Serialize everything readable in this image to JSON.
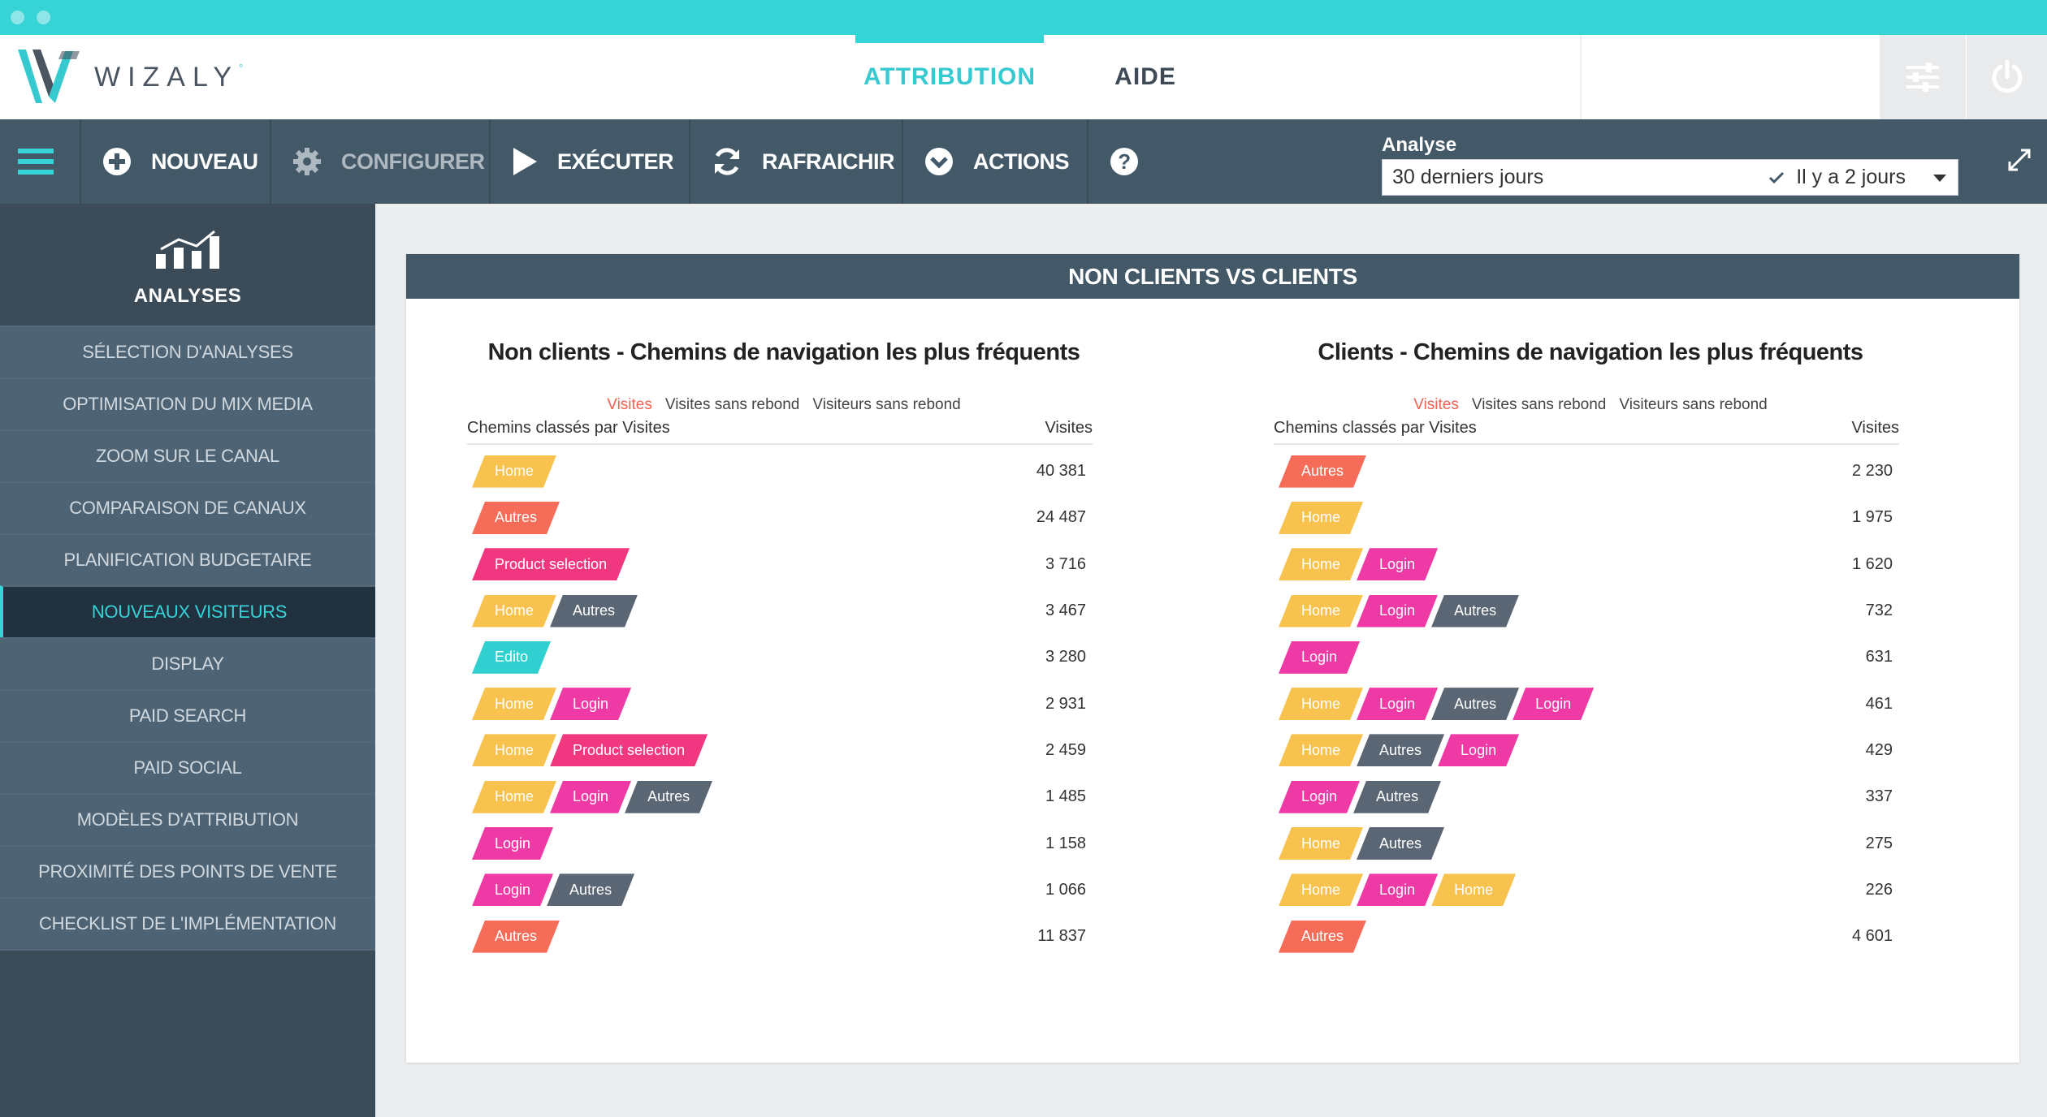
{
  "brand": {
    "name": "WIZALY",
    "mark": "°"
  },
  "top_nav": {
    "tabs": [
      "ATTRIBUTION",
      "AIDE"
    ],
    "active": 0
  },
  "toolbar": {
    "nouveau": "NOUVEAU",
    "configurer": "CONFIGURER",
    "executer": "EXÉCUTER",
    "rafraichir": "RAFRAICHIR",
    "actions": "ACTIONS"
  },
  "analyse": {
    "label": "Analyse",
    "value": "30 derniers jours",
    "selected": "Il y a 2 jours"
  },
  "sidebar": {
    "title": "ANALYSES",
    "items": [
      "SÉLECTION D'ANALYSES",
      "OPTIMISATION DU MIX MEDIA",
      "ZOOM SUR LE CANAL",
      "COMPARAISON DE CANAUX",
      "PLANIFICATION BUDGETAIRE",
      "NOUVEAUX VISITEURS",
      "DISPLAY",
      "PAID SEARCH",
      "PAID SOCIAL",
      "MODÈLES D'ATTRIBUTION",
      "PROXIMITÉ DES POINTS DE VENTE",
      "CHECKLIST DE L'IMPLÉMENTATION"
    ],
    "active": 5
  },
  "card": {
    "title": "NON CLIENTS VS CLIENTS"
  },
  "chip_colors": {
    "Home": "#f8c24e",
    "Autres": "#5a6673",
    "Product selection": "#f0377f",
    "Login": "#ef3aa6",
    "Edito": "#2fd0cf"
  },
  "chip_colors_override": {
    "first_autres": "#f56c58"
  },
  "panels": [
    {
      "title": "Non clients - Chemins de navigation les plus fréquents",
      "legend": [
        "Visites",
        "Visites sans rebond",
        "Visiteurs sans rebond"
      ],
      "col_left": "Chemins classés par Visites",
      "col_right": "Visites",
      "rows": [
        {
          "path": [
            "Home"
          ],
          "value": "40 381"
        },
        {
          "path": [
            "Autres"
          ],
          "value": "24 487"
        },
        {
          "path": [
            "Product selection"
          ],
          "value": "3 716"
        },
        {
          "path": [
            "Home",
            "Autres"
          ],
          "value": "3 467"
        },
        {
          "path": [
            "Edito"
          ],
          "value": "3 280"
        },
        {
          "path": [
            "Home",
            "Login"
          ],
          "value": "2 931"
        },
        {
          "path": [
            "Home",
            "Product selection"
          ],
          "value": "2 459"
        },
        {
          "path": [
            "Home",
            "Login",
            "Autres"
          ],
          "value": "1 485"
        },
        {
          "path": [
            "Login"
          ],
          "value": "1 158"
        },
        {
          "path": [
            "Login",
            "Autres"
          ],
          "value": "1 066"
        },
        {
          "path": [
            "Autres"
          ],
          "value": "11 837"
        }
      ]
    },
    {
      "title": "Clients - Chemins de navigation les plus fréquents",
      "legend": [
        "Visites",
        "Visites sans rebond",
        "Visiteurs sans rebond"
      ],
      "col_left": "Chemins classés par Visites",
      "col_right": "Visites",
      "rows": [
        {
          "path": [
            "Autres"
          ],
          "value": "2 230"
        },
        {
          "path": [
            "Home"
          ],
          "value": "1 975"
        },
        {
          "path": [
            "Home",
            "Login"
          ],
          "value": "1 620"
        },
        {
          "path": [
            "Home",
            "Login",
            "Autres"
          ],
          "value": "732"
        },
        {
          "path": [
            "Login"
          ],
          "value": "631"
        },
        {
          "path": [
            "Home",
            "Login",
            "Autres",
            "Login"
          ],
          "value": "461"
        },
        {
          "path": [
            "Home",
            "Autres",
            "Login"
          ],
          "value": "429"
        },
        {
          "path": [
            "Login",
            "Autres"
          ],
          "value": "337"
        },
        {
          "path": [
            "Home",
            "Autres"
          ],
          "value": "275"
        },
        {
          "path": [
            "Home",
            "Login",
            "Home"
          ],
          "value": "226"
        },
        {
          "path": [
            "Autres"
          ],
          "value": "4 601"
        }
      ]
    }
  ]
}
